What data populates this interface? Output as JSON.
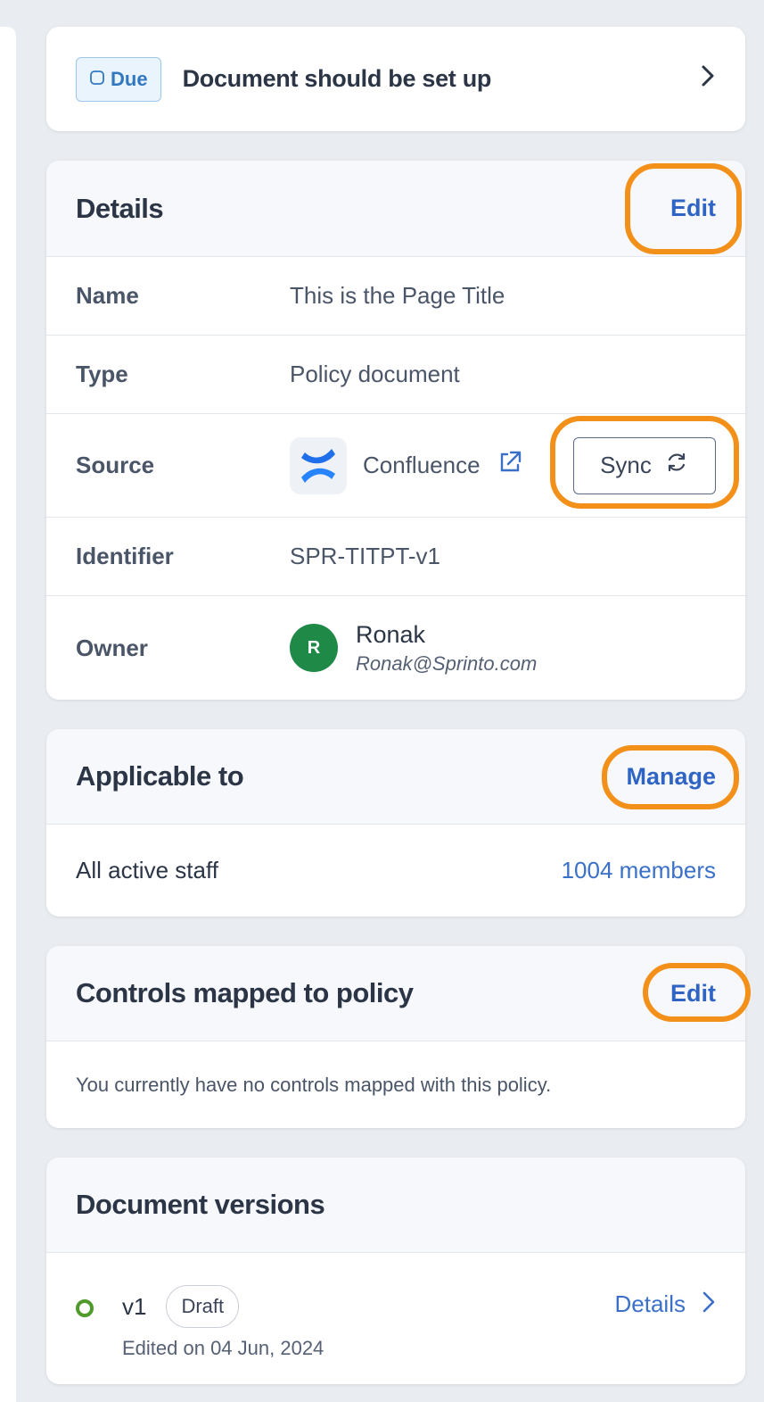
{
  "due_banner": {
    "badge_label": "Due",
    "text": "Document should be set up"
  },
  "details": {
    "title": "Details",
    "edit_label": "Edit",
    "rows": {
      "name_label": "Name",
      "name_value": "This is the Page Title",
      "type_label": "Type",
      "type_value": "Policy document",
      "source_label": "Source",
      "source_value": "Confluence",
      "sync_label": "Sync",
      "identifier_label": "Identifier",
      "identifier_value": "SPR-TITPT-v1",
      "owner_label": "Owner",
      "owner_initial": "R",
      "owner_name": "Ronak",
      "owner_email": "Ronak@Sprinto.com"
    }
  },
  "applicable": {
    "title": "Applicable to",
    "manage_label": "Manage",
    "group": "All active staff",
    "members": "1004 members"
  },
  "controls": {
    "title": "Controls mapped to policy",
    "edit_label": "Edit",
    "empty_text": "You currently have no controls mapped with this policy."
  },
  "versions": {
    "title": "Document versions",
    "items": [
      {
        "version": "v1",
        "status": "Draft",
        "edited": "Edited on 04 Jun, 2024",
        "details_label": "Details"
      }
    ]
  },
  "colors": {
    "accent": "#2f64c4",
    "highlight": "#f2901a",
    "avatar": "#1f8a48",
    "status_dot": "#4f9a2a"
  }
}
